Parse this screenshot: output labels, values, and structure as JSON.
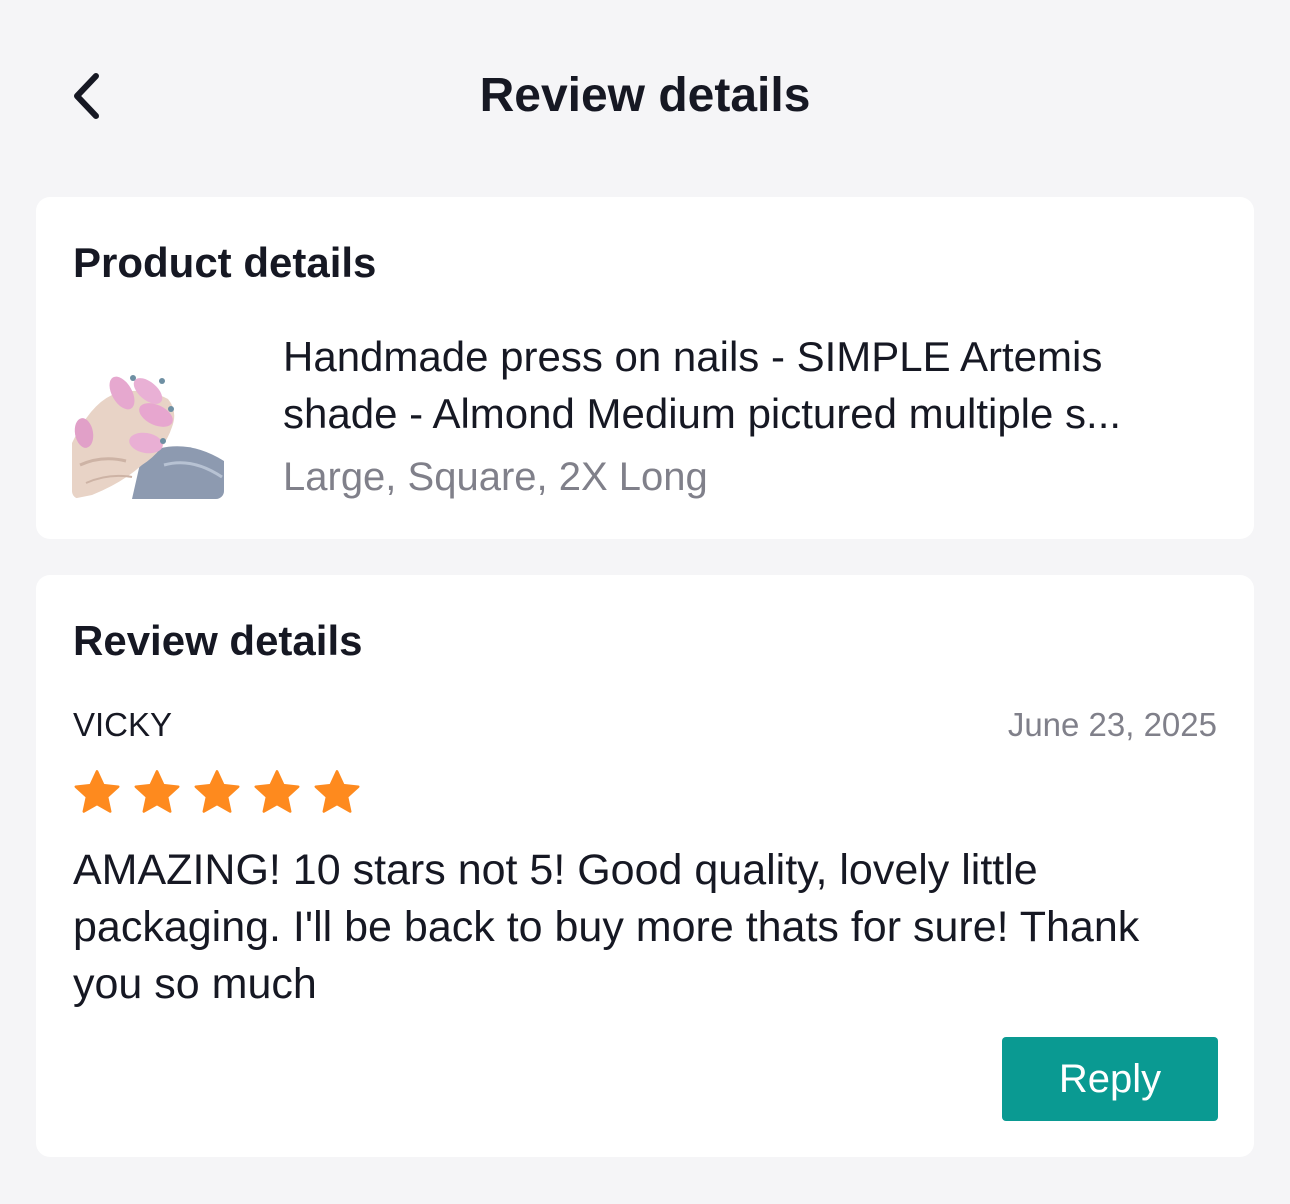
{
  "header": {
    "title": "Review details",
    "back_icon": "chevron-left-icon"
  },
  "product_card": {
    "title": "Product details",
    "product_name": "Handmade press on nails - SIMPLE Artemis shade - Almond Medium pictured multiple s...",
    "variant": "Large, Square, 2X Long",
    "thumbnail": "product-thumbnail-image"
  },
  "review_card": {
    "title": "Review details",
    "reviewer": "VICKY",
    "date": "June 23, 2025",
    "rating": 5,
    "rating_max": 5,
    "text": "AMAZING! 10 stars not 5! Good quality, lovely little packaging. I'll be back to buy more thats for sure! Thank you so much",
    "reply_label": "Reply"
  },
  "colors": {
    "background": "#f5f5f7",
    "card": "#ffffff",
    "star": "#fe8a1e",
    "reply_button": "#0a9a92",
    "secondary_text": "#80808a",
    "primary_text": "#161823"
  }
}
